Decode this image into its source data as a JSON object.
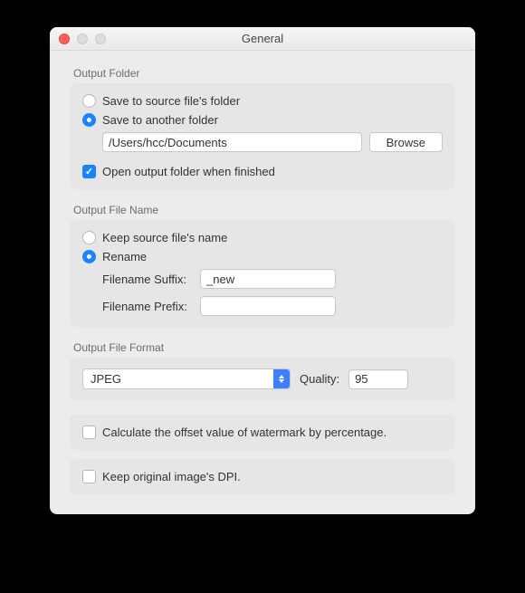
{
  "window": {
    "title": "General"
  },
  "outputFolder": {
    "sectionLabel": "Output Folder",
    "saveToSourceLabel": "Save to source file's folder",
    "saveToAnotherLabel": "Save to another folder",
    "pathValue": "/Users/hcc/Documents",
    "browseLabel": "Browse",
    "openWhenFinishedLabel": "Open output folder when finished"
  },
  "outputFileName": {
    "sectionLabel": "Output File Name",
    "keepSourceLabel": "Keep source file's name",
    "renameLabel": "Rename",
    "suffixLabel": "Filename Suffix:",
    "suffixValue": "_new",
    "prefixLabel": "Filename Prefix:",
    "prefixValue": ""
  },
  "outputFormat": {
    "sectionLabel": "Output File Format",
    "formatValue": "JPEG",
    "qualityLabel": "Quality:",
    "qualityValue": "95"
  },
  "options": {
    "offsetByPercentLabel": "Calculate the offset value of watermark by percentage.",
    "keepDpiLabel": "Keep original image's DPI."
  }
}
